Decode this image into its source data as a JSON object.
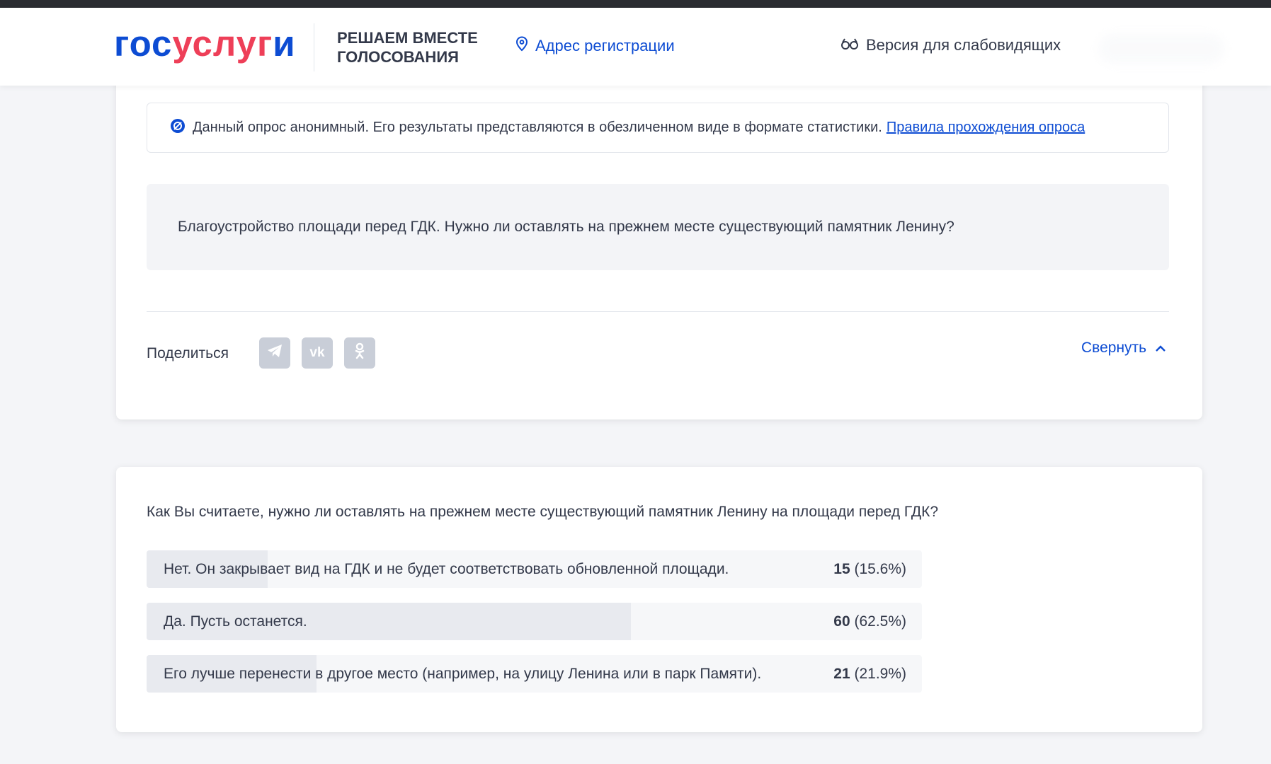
{
  "header": {
    "logo": {
      "part1": "гос",
      "part2": "услуг",
      "part3": "и"
    },
    "project_line1": "РЕШАЕМ ВМЕСТЕ",
    "project_line2": "ГОЛОСОВАНИЯ",
    "address_link": "Адрес регистрации",
    "vision_link": "Версия для слабовидящих",
    "icons": {
      "address": "location-pin-icon",
      "vision": "glasses-icon"
    }
  },
  "notice": {
    "icon": "anonymous-icon",
    "text": "Данный опрос анонимный. Его результаты представляются в обезличенном виде в формате статистики.",
    "link": "Правила прохождения опроса"
  },
  "question_box": "Благоустройство площади перед ГДК. Нужно ли оставлять на прежнем месте существующий памятник Ленину?",
  "share": {
    "label": "Поделиться",
    "buttons": [
      {
        "icon": "telegram-icon"
      },
      {
        "icon": "vk-icon",
        "text": "vk"
      },
      {
        "icon": "odnoklassniki-icon"
      }
    ]
  },
  "collapse_link": "Свернуть",
  "poll": {
    "question": "Как Вы считаете, нужно ли оставлять на прежнем месте существующий памятник Ленину на площади перед ГДК?",
    "answers": [
      {
        "label": "Нет. Он закрывает вид на ГДК и не будет соответствовать обновленной площади.",
        "count": "15",
        "percent": "(15.6%)",
        "share": 0.156
      },
      {
        "label": "Да. Пусть останется.",
        "count": "60",
        "percent": "(62.5%)",
        "share": 0.625
      },
      {
        "label": "Его лучше перенести в другое место (например, на улицу Ленина или в парк Памяти).",
        "count": "21",
        "percent": "(21.9%)",
        "share": 0.219
      }
    ]
  },
  "colors": {
    "brand_blue": "#0d4cd3",
    "brand_red": "#ee3f58",
    "text": "#33394a",
    "bar_fill": "#e8eaef",
    "share_btn": "#c9ced8"
  }
}
